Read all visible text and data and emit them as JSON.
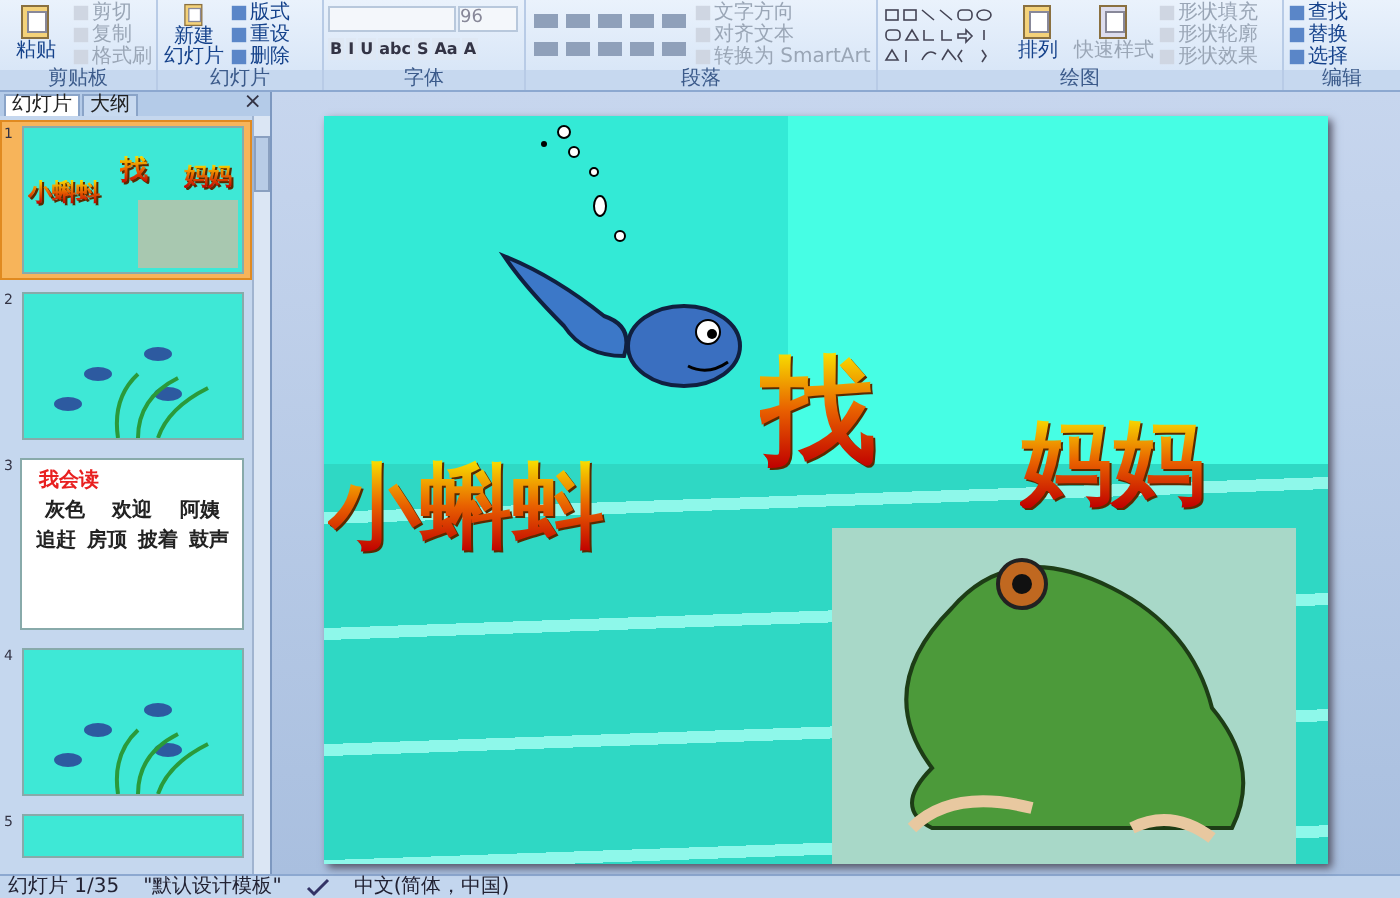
{
  "ribbon": {
    "groups": [
      {
        "kind": "clipboard",
        "label": "剪贴板",
        "large": [
          {
            "label": "粘贴",
            "disabled": false
          }
        ],
        "small": [
          {
            "label": "剪切",
            "disabled": true
          },
          {
            "label": "复制",
            "disabled": true
          },
          {
            "label": "格式刷",
            "disabled": true
          }
        ]
      },
      {
        "kind": "slides",
        "label": "幻灯片",
        "large": [
          {
            "lines": [
              "新建",
              "幻灯片"
            ],
            "disabled": false
          }
        ],
        "small": [
          {
            "label": "版式",
            "disabled": false
          },
          {
            "label": "重设",
            "disabled": false
          },
          {
            "label": "删除",
            "disabled": false
          }
        ]
      },
      {
        "kind": "font",
        "label": "字体",
        "font_size": "96",
        "format_buttons": [
          "B",
          "I",
          "U",
          "abc",
          "S",
          "Aa",
          "A"
        ]
      },
      {
        "kind": "paragraph",
        "label": "段落",
        "small": [
          {
            "label": "文字方向",
            "disabled": true
          },
          {
            "label": "对齐文本",
            "disabled": true
          },
          {
            "label": "转换为 SmartArt",
            "disabled": true
          }
        ]
      },
      {
        "kind": "drawing",
        "label": "绘图",
        "large": [
          {
            "label": "排列",
            "disabled": false
          },
          {
            "label": "快速样式",
            "disabled": true
          }
        ],
        "small": [
          {
            "label": "形状填充",
            "disabled": true
          },
          {
            "label": "形状轮廓",
            "disabled": true
          },
          {
            "label": "形状效果",
            "disabled": true
          }
        ]
      },
      {
        "kind": "editing",
        "label": "编辑",
        "small": [
          {
            "label": "查找",
            "disabled": false
          },
          {
            "label": "替换",
            "disabled": false
          },
          {
            "label": "选择",
            "disabled": false
          }
        ]
      }
    ]
  },
  "panel": {
    "close": "×",
    "tabs": [
      {
        "label": "幻灯片",
        "selected": true
      },
      {
        "label": "大纲",
        "selected": false
      }
    ],
    "thumbnails": [
      {
        "number": "1",
        "kind": "title",
        "selected": true,
        "title_parts": [
          "小蝌蚪",
          "找",
          "妈妈"
        ]
      },
      {
        "number": "2",
        "kind": "picture",
        "selected": false
      },
      {
        "number": "3",
        "kind": "words",
        "selected": false,
        "heading": "我会读",
        "lines": [
          [
            "灰色",
            "欢迎",
            "阿姨"
          ],
          [
            "追赶",
            "房顶",
            "披着",
            "鼓声"
          ]
        ]
      },
      {
        "number": "4",
        "kind": "picture",
        "selected": false
      },
      {
        "number": "5",
        "kind": "blank",
        "selected": false
      }
    ]
  },
  "slide": {
    "title_parts": [
      "小蝌蚪",
      "找",
      "妈妈"
    ]
  },
  "status_bar": {
    "slide": "幻灯片 1/35",
    "theme": "\"默认设计模板\"",
    "language": "中文(简体，中国)"
  }
}
